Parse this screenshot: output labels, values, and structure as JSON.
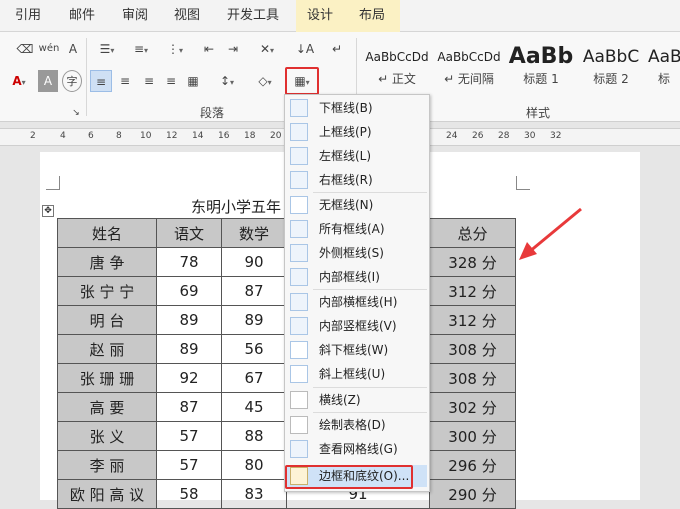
{
  "tabs": [
    "引用",
    "邮件",
    "审阅",
    "视图",
    "开发工具",
    "设计",
    "布局"
  ],
  "ribbon": {
    "paragraph_group_label": "段落",
    "styles_group_label": "样式",
    "styles": [
      {
        "sample": "AaBbCcDd",
        "name": "↵ 正文"
      },
      {
        "sample": "AaBbCcDd",
        "name": "↵ 无间隔"
      },
      {
        "sample": "AaBb",
        "name": "标题 1"
      },
      {
        "sample": "AaBbC",
        "name": "标题 2"
      },
      {
        "sample": "AaB",
        "name": "标"
      }
    ]
  },
  "ruler_marks": [
    "2",
    "4",
    "6",
    "8",
    "10",
    "12",
    "14",
    "16",
    "18",
    "20",
    "24",
    "26",
    "28",
    "30",
    "32"
  ],
  "document": {
    "title": "东明小学五年",
    "headers": [
      "姓名",
      "语文",
      "数学",
      "",
      "总分"
    ],
    "rows": [
      {
        "name": "唐 争",
        "chinese": "78",
        "math": "90",
        "total": "328 分"
      },
      {
        "name": "张 宁 宁",
        "chinese": "69",
        "math": "87",
        "total": "312 分"
      },
      {
        "name": "明 台",
        "chinese": "89",
        "math": "89",
        "total": "312 分"
      },
      {
        "name": "赵 丽",
        "chinese": "89",
        "math": "56",
        "total": "308 分"
      },
      {
        "name": "张 珊 珊",
        "chinese": "92",
        "math": "67",
        "total": "308 分"
      },
      {
        "name": "高 要",
        "chinese": "87",
        "math": "45",
        "total": "302 分"
      },
      {
        "name": "张 义",
        "chinese": "57",
        "math": "88",
        "total": "300 分"
      },
      {
        "name": "李 丽",
        "chinese": "57",
        "math": "80",
        "total": "296 分"
      },
      {
        "name": "欧 阳 高 议",
        "chinese": "58",
        "math": "83",
        "extra": "91",
        "total": "290 分"
      }
    ]
  },
  "border_menu": {
    "items": [
      "下框线(B)",
      "上框线(P)",
      "左框线(L)",
      "右框线(R)",
      "无框线(N)",
      "所有框线(A)",
      "外侧框线(S)",
      "内部框线(I)",
      "内部横框线(H)",
      "内部竖框线(V)",
      "斜下框线(W)",
      "斜上框线(U)",
      "横线(Z)",
      "绘制表格(D)",
      "查看网格线(G)",
      "边框和底纹(O)..."
    ],
    "highlighted": "边框和底纹(O)..."
  },
  "colors": {
    "highlight_red": "#e03030",
    "cell_gray": "#c8c8c8",
    "arrow_red": "#e8393a"
  }
}
